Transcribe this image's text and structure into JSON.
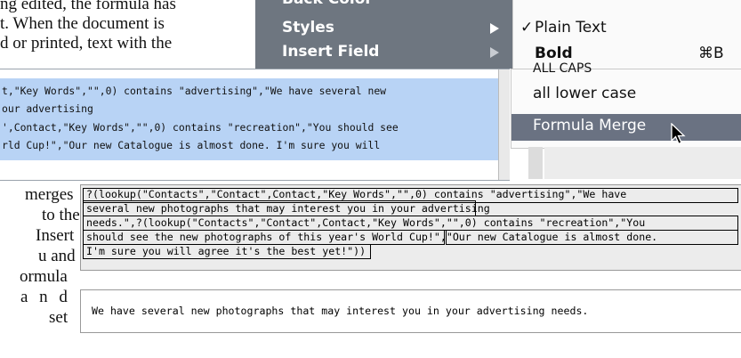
{
  "doc_top": {
    "line1": "ng edited, the formula has",
    "line2": "t. When the document is",
    "line3": "d or printed, text with the"
  },
  "doc_left": [
    "merges",
    "to the",
    "Insert",
    "u and",
    "ormula",
    "a n d",
    "set"
  ],
  "menu": {
    "partial_top": "Back Color",
    "styles": "Styles",
    "insert_field": "Insert Field"
  },
  "styles_submenu": {
    "plain_text": "Plain Text",
    "plain_check": "✓",
    "bold": "Bold",
    "bold_shortcut": "⌘B",
    "partial_caps": "ALL CAPS",
    "lower_case": "all lower case",
    "formula_merge": "Formula Merge"
  },
  "editor_lines": [
    "t,\"Key Words\",\"\",0) contains \"advertising\",\"We have several new",
    "our advertising",
    "',Contact,\"Key Words\",\"\",0) contains \"recreation\",\"You should see",
    "rld Cup!\",\"Our new Catalogue is almost done. I'm sure you will"
  ],
  "formula_lines": [
    "?(lookup(\"Contacts\",\"Contact\",Contact,\"Key Words\",\"\",0) contains \"advertising\",\"We have",
    "several new photographs that may interest you in your advertising",
    "needs.\",?(lookup(\"Contacts\",\"Contact\",Contact,\"Key Words\",\"\",0) contains \"recreation\",\"You",
    "should see the new photographs of this year's World Cup!\",\"Our new Catalogue is almost done.",
    "I'm sure you will agree it's the best yet!\"))"
  ],
  "result_text": "We have several new photographs that may interest you in your advertising needs."
}
